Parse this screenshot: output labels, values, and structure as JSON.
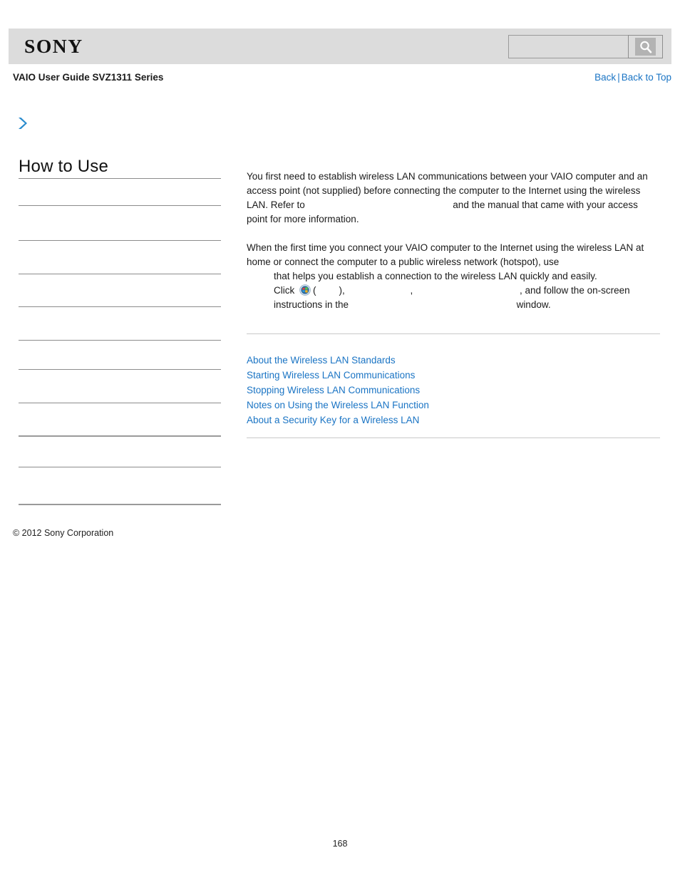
{
  "header": {
    "logo_text": "SONY",
    "search": {
      "value": "",
      "placeholder": "",
      "icon": "search-icon"
    }
  },
  "title_row": {
    "guide_title": "VAIO User Guide SVZ1311 Series",
    "back_label": "Back",
    "separator": "|",
    "back_to_top_label": "Back to Top"
  },
  "sidebar": {
    "chevron_icon": "chevron-right-icon",
    "heading": "How to Use",
    "items": [
      {
        "label": ""
      },
      {
        "label": ""
      },
      {
        "label": ""
      },
      {
        "label": ""
      },
      {
        "label": ""
      },
      {
        "label": ""
      },
      {
        "label": ""
      },
      {
        "label": ""
      },
      {
        "label": ""
      },
      {
        "label": ""
      }
    ],
    "copyright": "© 2012 Sony Corporation"
  },
  "content": {
    "paragraph1": {
      "part1": "You first need to establish wireless LAN communications between your VAIO computer and an access point (not supplied) before connecting the computer to the Internet using the wireless LAN. Refer to ",
      "link_gap": "",
      "part2": " and the manual that came with your access point for more information."
    },
    "paragraph2": {
      "part1": "When the first time you connect your VAIO computer to the Internet using the wireless LAN at home or connect the computer to a public wireless network (hotspot), use ",
      "app_gap": "",
      "part2": " that helps you establish a connection to the wireless LAN quickly and easily.",
      "click_word": "Click ",
      "start_orb_icon": "windows-start-orb-icon",
      "open_paren": "(",
      "start_gap": "",
      "close_paren": "), ",
      "menu_gap1": "",
      "comma1": ", ",
      "menu_gap2": "",
      "part3": ", and follow the on-screen instructions in the ",
      "window_gap": "",
      "part4": " window."
    },
    "related_links": [
      {
        "label": "About the Wireless LAN Standards"
      },
      {
        "label": "Starting Wireless LAN Communications"
      },
      {
        "label": "Stopping Wireless LAN Communications"
      },
      {
        "label": "Notes on Using the Wireless LAN Function"
      },
      {
        "label": "About a Security Key for a Wireless LAN"
      }
    ]
  },
  "footer": {
    "page_number": "168"
  },
  "colors": {
    "link": "#1a74c4",
    "header_bg": "#dcdcdc",
    "rule": "#8c8c8c",
    "content_rule": "#c9c9c9"
  }
}
